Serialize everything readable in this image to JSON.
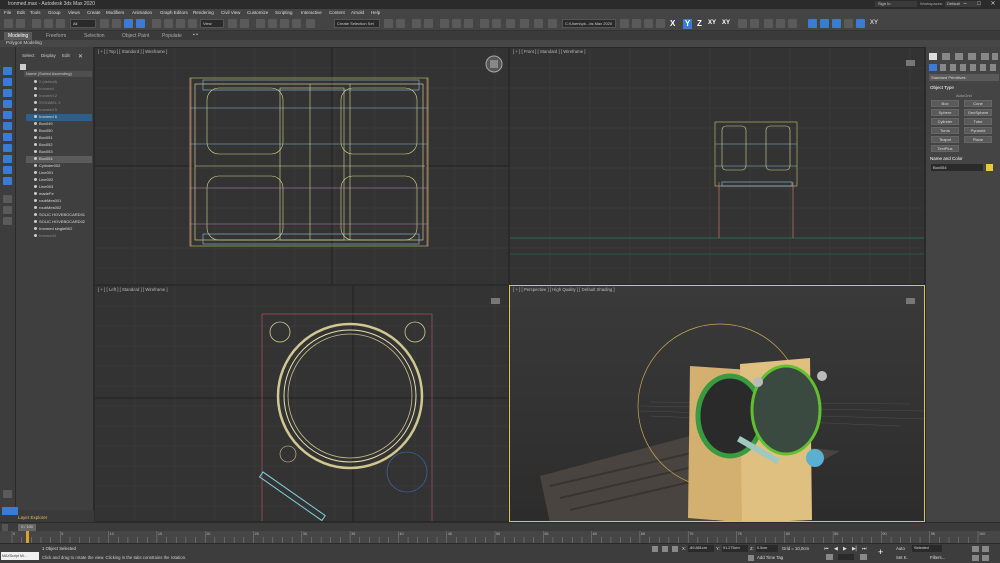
{
  "app": {
    "title": "Ironmed.max - Autodesk 3ds Max 2020",
    "sign_in": "Sign In",
    "workspaces_label": "Workspaces:",
    "workspaces_value": "Default"
  },
  "menu": [
    "File",
    "Edit",
    "Tools",
    "Group",
    "Views",
    "Create",
    "Modifiers",
    "Animation",
    "Graph Editors",
    "Rendering",
    "Civil View",
    "Customize",
    "Scripting",
    "Interactive",
    "Content",
    "Arnold",
    "Help"
  ],
  "toolbar": {
    "filter_value": "All",
    "view_value": "View",
    "selection_set": "Create Selection Set",
    "path_value": "C:\\Users\\pk...ds Max 2020",
    "axis_x": "X",
    "axis_y": "Y",
    "axis_z": "Z",
    "axis_xy": "XY",
    "axis_xy2": "XY"
  },
  "ribbon": {
    "tabs": [
      "Modeling",
      "Freeform",
      "Selection",
      "Object Paint",
      "Populate"
    ],
    "active": "Modeling",
    "sub": "Polygon Modeling"
  },
  "explorer": {
    "tabs": [
      "Select",
      "Display",
      "Edit"
    ],
    "header": "Name (Sorted Ascending)",
    "rows": [
      {
        "label": "0 (default)",
        "style": "dim"
      },
      {
        "label": "Ironmed",
        "style": "dim"
      },
      {
        "label": "Ironmed 2",
        "style": "dim"
      },
      {
        "label": "IRONMEL 3",
        "style": "dim"
      },
      {
        "label": "Ironmed 5",
        "style": "dim"
      },
      {
        "label": "Ironmed 6",
        "style": "sel"
      },
      {
        "label": "Box049",
        "style": ""
      },
      {
        "label": "Box050",
        "style": ""
      },
      {
        "label": "Box051",
        "style": ""
      },
      {
        "label": "Box052",
        "style": ""
      },
      {
        "label": "Box053",
        "style": ""
      },
      {
        "label": "Box054",
        "style": "hi"
      },
      {
        "label": "Cylinder002",
        "style": ""
      },
      {
        "label": "Line001",
        "style": ""
      },
      {
        "label": "Line002",
        "style": ""
      },
      {
        "label": "Line003",
        "style": ""
      },
      {
        "label": "madeFe",
        "style": ""
      },
      {
        "label": "roubMes001",
        "style": ""
      },
      {
        "label": "roubMes002",
        "style": ""
      },
      {
        "label": "SOLIC HOVEBOCARD01",
        "style": ""
      },
      {
        "label": "SOLIC HOVEBOCARD02",
        "style": ""
      },
      {
        "label": "Ironmed singleB02",
        "style": ""
      },
      {
        "label": "Ironmed4",
        "style": "dim"
      }
    ],
    "layer_explorer": "Layer Explorer",
    "layer_field": "0 | 100"
  },
  "viewports": {
    "top": "[ + ] [ Top ] [ Standard ] [ Wireframe ]",
    "front": "[ + ] [ Front ] [ Standard ] [ Wireframe ]",
    "left": "[ + ] [ Left ] [ Standard ] [ Wireframe ]",
    "persp": "[ + ] [ Perspective ] [ High Quality ] [ Default Shading ]"
  },
  "command_panel": {
    "dropdown": "Standard Primitives",
    "object_type": "Object Type",
    "autogrid": "AutoGrid",
    "buttons": [
      "Box",
      "Cone",
      "Sphere",
      "GeoSphere",
      "Cylinder",
      "Tube",
      "Torus",
      "Pyramid",
      "Teapot",
      "Plane",
      "TextPlus"
    ],
    "name_color": "Name and Color",
    "name_value": "Box054",
    "swatch_color": "#e8c840"
  },
  "timeline": {
    "frame": "0 / 100",
    "ticks": [
      "0",
      "5",
      "10",
      "15",
      "20",
      "25",
      "30",
      "35",
      "40",
      "45",
      "50",
      "55",
      "60",
      "65",
      "70",
      "75",
      "80",
      "85",
      "90",
      "95",
      "100"
    ]
  },
  "status": {
    "maxscript": "MAXScript Mi...",
    "selected": "1 Object Selected",
    "prompt": "Click and drag to rotate the view.  Clicking in the tabs constrains the rotation.",
    "x_label": "X:",
    "x_value": "-89.881cm",
    "y_label": "Y:",
    "y_value": "91.275cm",
    "z_label": "Z:",
    "z_value": "0.0cm",
    "grid": "Grid = 10,0cm",
    "add_time_tag": "Add Time Tag",
    "auto": "Auto",
    "selected_dd": "Selected",
    "set_k": "Set K.",
    "filters": "Filters..."
  }
}
